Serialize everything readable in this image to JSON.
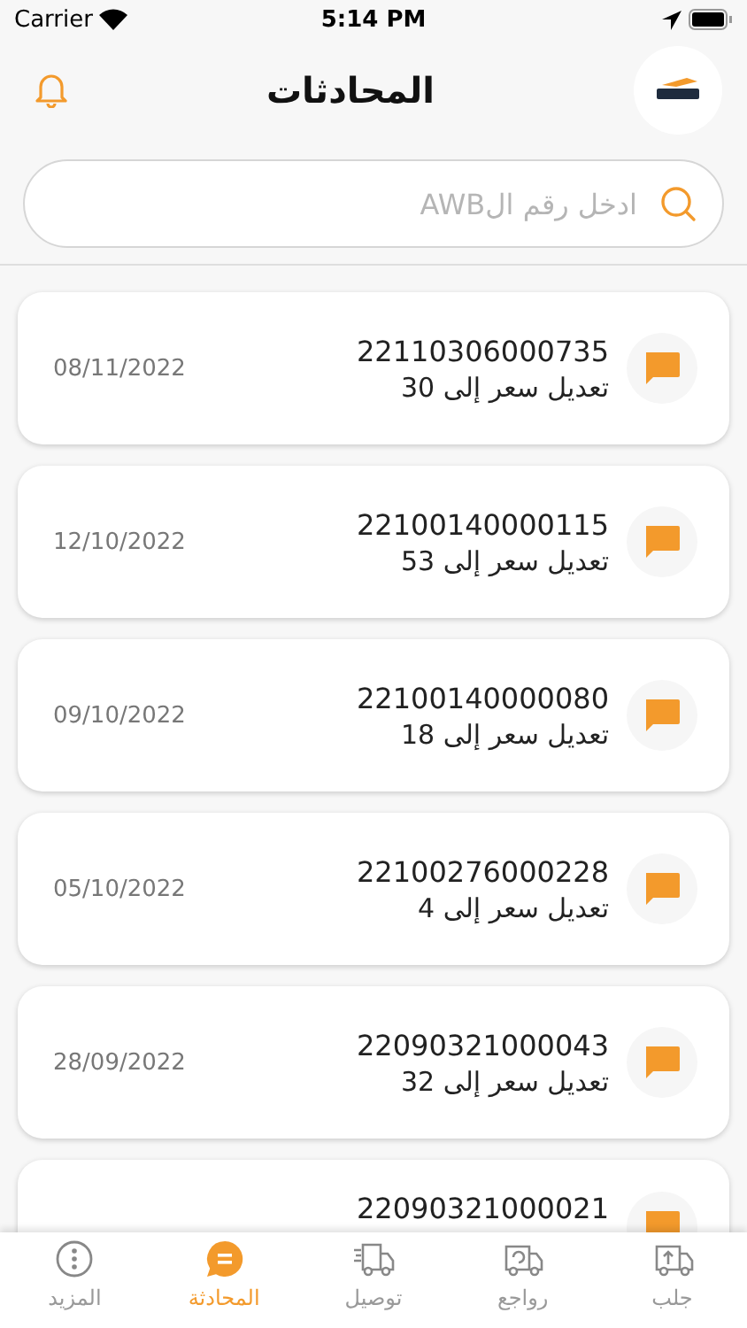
{
  "status_bar": {
    "carrier": "Carrier",
    "time": "5:14 PM"
  },
  "header": {
    "title": "المحادثات"
  },
  "search": {
    "placeholder": "ادخل رقم الAWB"
  },
  "conversations": [
    {
      "number": "22110306000735",
      "subject": "تعديل سعر إلى 30",
      "date": "08/11/2022"
    },
    {
      "number": "22100140000115",
      "subject": "تعديل سعر إلى 53",
      "date": "12/10/2022"
    },
    {
      "number": "22100140000080",
      "subject": "تعديل سعر إلى 18",
      "date": "09/10/2022"
    },
    {
      "number": "22100276000228",
      "subject": "تعديل سعر إلى 4",
      "date": "05/10/2022"
    },
    {
      "number": "22090321000043",
      "subject": "تعديل سعر إلى 32",
      "date": "28/09/2022"
    },
    {
      "number": "22090321000021"
    }
  ],
  "tabs": [
    {
      "kind": "pickup",
      "label": "جلب",
      "selected": false
    },
    {
      "kind": "returns",
      "label": "رواجع",
      "selected": false
    },
    {
      "kind": "delivery",
      "label": "توصيل",
      "selected": false
    },
    {
      "kind": "chat",
      "label": "المحادثة",
      "selected": true
    },
    {
      "kind": "more",
      "label": "المزيد",
      "selected": false
    }
  ]
}
